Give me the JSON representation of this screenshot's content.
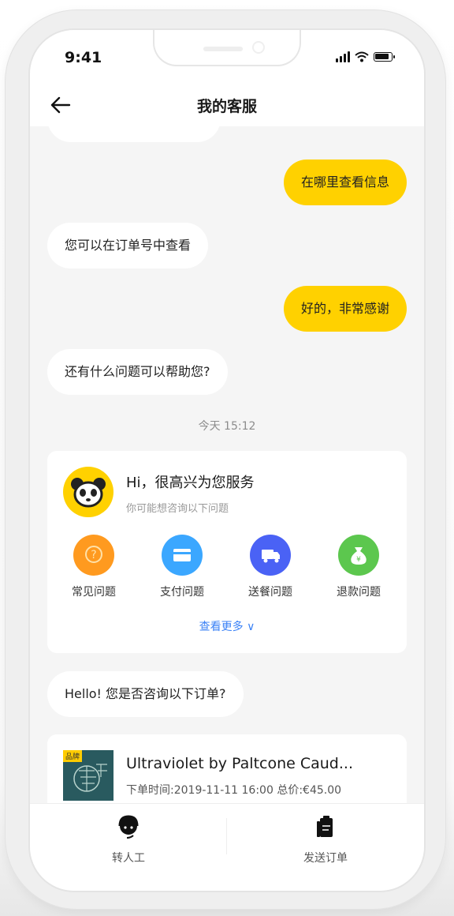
{
  "status_bar": {
    "time": "9:41"
  },
  "nav": {
    "title": "我的客服"
  },
  "messages": {
    "m1": "在哪里查看信息",
    "m2": "您可以在订单号中查看",
    "m3": "好的，非常感谢",
    "m4": "还有什么问题可以帮助您?",
    "m5": "Hello!  您是否咨询以下订单?"
  },
  "timestamp": "今天 15:12",
  "service_card": {
    "greeting": "Hi，很高兴为您服务",
    "subtitle": "你可能想咨询以下问题",
    "categories": [
      {
        "label": "常见问题",
        "icon": "question-icon",
        "color": "#ff9a1f"
      },
      {
        "label": "支付问题",
        "icon": "card-icon",
        "color": "#3ba7ff"
      },
      {
        "label": "送餐问题",
        "icon": "truck-icon",
        "color": "#4a62f5"
      },
      {
        "label": "退款问题",
        "icon": "money-bag-icon",
        "color": "#5cc74e"
      }
    ],
    "more": "查看更多 ∨"
  },
  "order_card": {
    "tag": "品牌",
    "title": "Ultraviolet by Paltcone Caud...",
    "meta": "下单时间:2019-11-11 16:00   总价:€45.00"
  },
  "bottom_bar": {
    "agent_label": "转人工",
    "send_order_label": "发送订单"
  },
  "colors": {
    "accent": "#ffd100",
    "link": "#3b82f6"
  }
}
